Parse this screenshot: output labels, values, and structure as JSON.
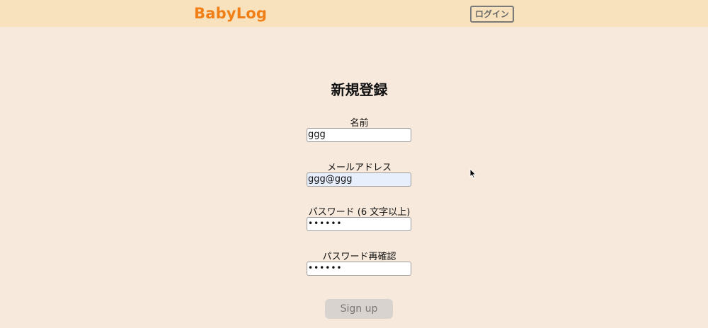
{
  "header": {
    "brand": "BabyLog",
    "login_label": "ログイン",
    "brand_color": "#f07f17",
    "background_color": "#f8e2bd"
  },
  "page": {
    "background_color": "#f7e9dc",
    "title": "新規登録"
  },
  "form": {
    "fields": [
      {
        "label": "名前",
        "value": "ggg"
      },
      {
        "label": "メールアドレス",
        "value": "ggg@ggg",
        "autofilled": true
      },
      {
        "label": "パスワード (6 文字以上)",
        "value": "••••••",
        "masked": true
      },
      {
        "label": "パスワード再確認",
        "value": "••••••",
        "masked": true
      }
    ],
    "submit_label": "Sign up"
  },
  "cursor": {
    "icon": "mouse-pointer-icon"
  }
}
